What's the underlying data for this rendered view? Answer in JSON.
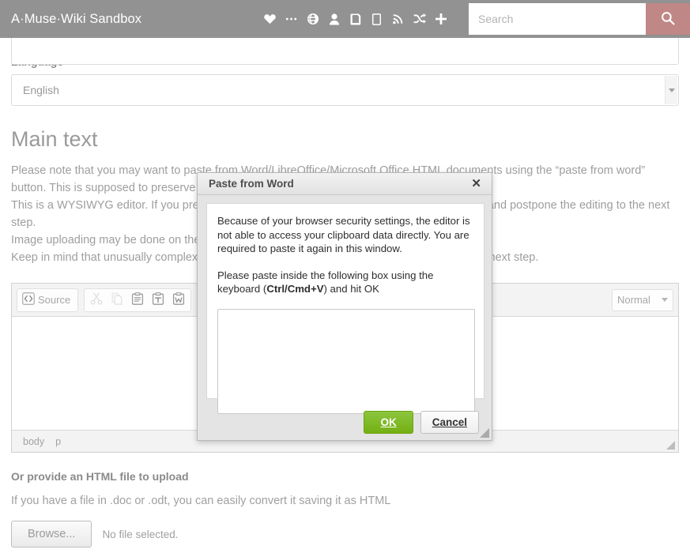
{
  "header": {
    "brand": "A·Muse·Wiki Sandbox",
    "icons": [
      {
        "name": "heart-icon",
        "label": "Favorites"
      },
      {
        "name": "ellipsis-icon",
        "label": "More"
      },
      {
        "name": "globe-icon",
        "label": "Language"
      },
      {
        "name": "user-icon",
        "label": "Author"
      },
      {
        "name": "book-icon",
        "label": "Library"
      },
      {
        "name": "tablet-icon",
        "label": "Bookbuilder"
      },
      {
        "name": "rss-icon",
        "label": "Feed"
      },
      {
        "name": "shuffle-icon",
        "label": "Random"
      },
      {
        "name": "plus-icon",
        "label": "Add"
      }
    ],
    "search_placeholder": "Search",
    "search_value": "",
    "search_button_icon": "search-icon",
    "bar_color": "#929292",
    "search_button_color": "#c08787"
  },
  "form": {
    "language_label": "Language",
    "language_value": "English",
    "main_text_heading": "Main text",
    "paragraphs": [
      "Please note that you may want to paste from Word/LibreOffice/Microsoft Office HTML documents using the “paste from word” button. This is supposed to preserve the markup.",
      "This is a WYSIWYG editor. If you prefer to use the muse markup, you can upload a file above and postpone the editing to the next step.",
      "Image uploading may be done on the next step, after the text creation.",
      "Keep in mind that unusually complex formatting may be lost. You may add images only on the next step."
    ],
    "upload_heading": "Or provide an HTML file to upload",
    "upload_note": "If you have a file in .doc or .odt, you can easily convert it saving it as HTML",
    "browse_label": "Browse...",
    "no_file_label": "No file selected."
  },
  "editor": {
    "source_label": "Source",
    "toolbar_icons": [
      {
        "name": "source-icon",
        "label": "Source"
      },
      {
        "name": "cut-icon",
        "label": "Cut"
      },
      {
        "name": "copy-icon",
        "label": "Copy"
      },
      {
        "name": "paste-icon",
        "label": "Paste"
      },
      {
        "name": "paste-text-icon",
        "label": "Paste as plain text"
      },
      {
        "name": "paste-word-icon",
        "label": "Paste from Word"
      }
    ],
    "format_value": "Normal",
    "path": [
      "body",
      "p"
    ]
  },
  "dialog": {
    "title": "Paste from Word",
    "close_icon": "close-icon",
    "body_paragraph_1": "Because of your browser security settings, the editor is not able to access your clipboard data directly. You are required to paste it again in this window.",
    "body_paragraph_2_pre": "Please paste inside the following box using the keyboard (",
    "body_paragraph_2_bold": "Ctrl/Cmd+V",
    "body_paragraph_2_post": ") and hit OK",
    "paste_area_value": "",
    "ok_label": "OK",
    "cancel_label": "Cancel",
    "ok_color": "#7fbb22"
  }
}
